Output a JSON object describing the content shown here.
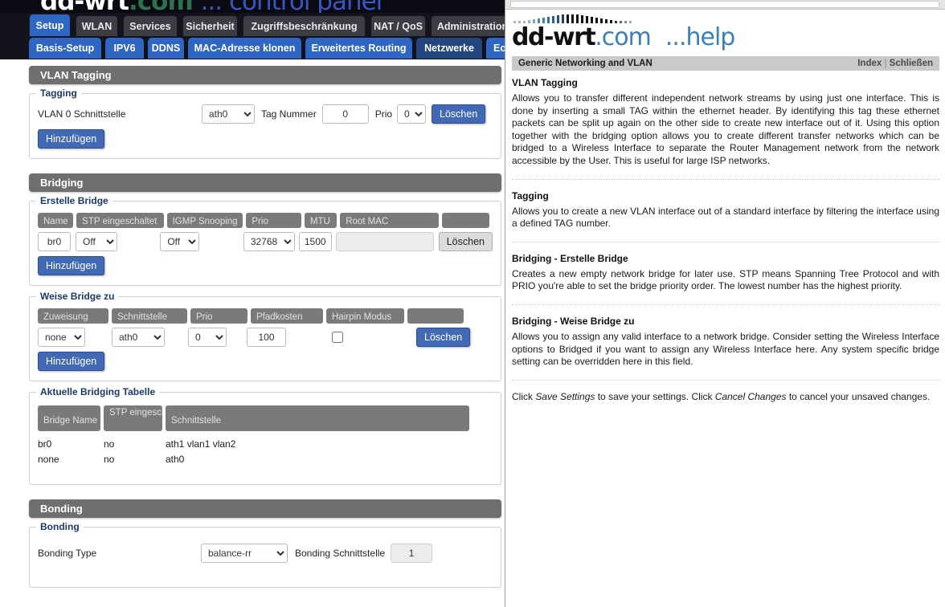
{
  "router": {
    "logo": {
      "brand": "dd-wrt",
      "com": ".com",
      "tagline": "... control panel"
    },
    "tabs_primary": [
      {
        "label": "Setup",
        "active": true
      },
      {
        "label": "WLAN",
        "active": false
      },
      {
        "label": "Services",
        "active": false
      },
      {
        "label": "Sicherheit",
        "active": false
      },
      {
        "label": "Zugriffsbeschränkung",
        "active": false
      },
      {
        "label": "NAT / QoS",
        "active": false
      },
      {
        "label": "Administration",
        "active": false
      }
    ],
    "tabs_secondary": [
      {
        "label": "Basis-Setup",
        "active": false
      },
      {
        "label": "IPV6",
        "active": false
      },
      {
        "label": "DDNS",
        "active": false
      },
      {
        "label": "MAC-Adresse klonen",
        "active": false
      },
      {
        "label": "Erweitertes Routing",
        "active": false
      },
      {
        "label": "Netzwerke",
        "active": true
      },
      {
        "label": "Eo",
        "active": false
      }
    ],
    "vlan": {
      "section_title": "VLAN Tagging",
      "legend": "Tagging",
      "row_label": "VLAN 0 Schnittstelle",
      "interface_value": "ath0",
      "tag_label": "Tag Nummer",
      "tag_value": "0",
      "prio_label": "Prio",
      "prio_value": "0",
      "delete_label": "Löschen",
      "add_label": "Hinzufügen"
    },
    "bridging": {
      "section_title": "Bridging",
      "create": {
        "legend": "Erstelle Bridge",
        "headers": [
          "Name",
          "STP eingeschaltet",
          "IGMP Snooping",
          "Prio",
          "MTU",
          "Root MAC",
          ""
        ],
        "name_value": "br0",
        "stp_value": "Off",
        "igmp_value": "Off",
        "prio_value": "32768",
        "mtu_value": "1500",
        "rootmac_value": "",
        "delete_label": "Löschen",
        "add_label": "Hinzufügen"
      },
      "assign": {
        "legend": "Weise Bridge zu",
        "headers": [
          "Zuweisung",
          "Schnittstelle",
          "Prio",
          "Pfadkosten",
          "Hairpin Modus",
          ""
        ],
        "assignment_value": "none",
        "interface_value": "ath0",
        "prio_value": "0",
        "pathcost_value": "100",
        "hairpin_checked": false,
        "delete_label": "Löschen",
        "add_label": "Hinzufügen"
      },
      "table": {
        "legend": "Aktuelle Bridging Tabelle",
        "headers": [
          "Bridge Name",
          "STP eingeschaltet",
          "Schnittstelle"
        ],
        "rows": [
          {
            "name": "br0",
            "stp": "no",
            "interface": "ath1 vlan1 vlan2"
          },
          {
            "name": "none",
            "stp": "no",
            "interface": "ath0"
          }
        ]
      }
    },
    "bonding": {
      "section_title": "Bonding",
      "legend": "Bonding",
      "type_label": "Bonding Type",
      "type_value": "balance-rr",
      "iface_label": "Bonding Schnittstelle",
      "iface_value": "1"
    }
  },
  "help": {
    "logo": {
      "brand": "dd-wrt",
      "com": ".com",
      "help_word": "...help"
    },
    "titlebar": {
      "title": "Generic Networking and VLAN",
      "index": "Index",
      "separator": "|",
      "close": "Schließen"
    },
    "sections": [
      {
        "heading": "VLAN Tagging",
        "body": "Allows you to transfer different independent network streams by using just one interface. This is done by inserting a small TAG within the ethernet header. By identifying this tag these ethernet packets can be split up again on the other side to create new interface out of it. Using this option together with the bridging option allows you to create different transfer networks which can be bridged to a Wireless Interface to separate the Router Management network from the network accessible by the User. This is useful for large ISP networks."
      },
      {
        "heading": "Tagging",
        "body": "Allows you to create a new VLAN interface out of a standard interface by filtering the interface using a defined TAG number."
      },
      {
        "heading": "Bridging - Erstelle Bridge",
        "body": "Creates a new empty network bridge for later use. STP means Spanning Tree Protocol and with PRIO you're able to set the bridge priority order. The lowest number has the highest priority."
      },
      {
        "heading": "Bridging - Weise Bridge zu",
        "body": "Allows you to assign any valid interface to a network bridge. Consider setting the Wireless Interface options to Bridged if you want to assign any Wireless Interface here. Any system specific bridge setting can be overridden here in this field."
      }
    ],
    "footer": {
      "pre": "Click ",
      "save": "Save Settings",
      "mid": " to save your settings. Click ",
      "cancel": "Cancel Changes",
      "post": " to cancel your unsaved changes."
    }
  },
  "colors": {
    "accent_blue": "#4169b4",
    "tab_blue": "#2f66c4",
    "section_gray": "#6f6f6f",
    "header_pill_gray": "#7a7a7a",
    "help_link_blue": "#3b7fb8"
  }
}
